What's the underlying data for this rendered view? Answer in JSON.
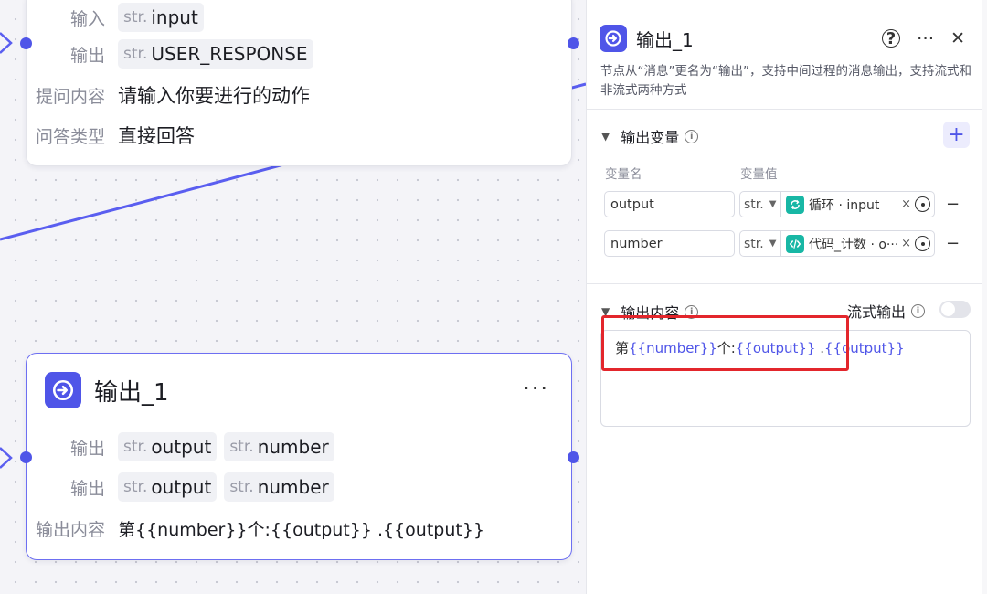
{
  "canvas": {
    "top_node": {
      "rows": [
        {
          "label": "输入",
          "chips": [
            {
              "type": "str.",
              "name": "input"
            }
          ]
        },
        {
          "label": "输出",
          "chips": [
            {
              "type": "str.",
              "name": "USER_RESPONSE"
            }
          ]
        },
        {
          "label": "提问内容",
          "text": "请输入你要进行的动作"
        },
        {
          "label": "问答类型",
          "text": "直接回答"
        }
      ]
    },
    "output_node": {
      "title": "输出_1",
      "more": "···",
      "rows": [
        {
          "label": "输出",
          "chips": [
            {
              "type": "str.",
              "name": "output"
            },
            {
              "type": "str.",
              "name": "number"
            }
          ]
        },
        {
          "label": "输出",
          "chips": [
            {
              "type": "str.",
              "name": "output"
            },
            {
              "type": "str.",
              "name": "number"
            }
          ]
        },
        {
          "label": "输出内容",
          "text": "第{{number}}个:{{output}} .{{output}}"
        }
      ]
    }
  },
  "panel": {
    "title": "输出_1",
    "help": "?",
    "more": "···",
    "close": "✕",
    "description": "节点从“消息”更名为“输出”，支持中间过程的消息输出，支持流式和非流式两种方式",
    "output_vars": {
      "title": "输出变量",
      "add": "+",
      "col_name": "变量名",
      "col_value": "变量值",
      "rows": [
        {
          "name": "output",
          "type": "str.",
          "ref": "循环 · input",
          "ref_icon": "loop-icon",
          "clear": "×",
          "remove": "−"
        },
        {
          "name": "number",
          "type": "str.",
          "ref": "代码_计数 · o···",
          "ref_icon": "code-icon",
          "clear": "×",
          "remove": "−"
        }
      ]
    },
    "output_content": {
      "title": "输出内容",
      "stream_label": "流式输出",
      "stream_on": false,
      "parts": [
        {
          "text": "第",
          "var": false
        },
        {
          "text": "{{number}}",
          "var": true
        },
        {
          "text": "个:",
          "var": false
        },
        {
          "text": "{{output}}",
          "var": true
        },
        {
          "text": " .",
          "var": false
        },
        {
          "text": "{{output}}",
          "var": true
        }
      ]
    }
  },
  "colors": {
    "accent": "#4f55e8",
    "ref_icon_bg": "#18b7a5",
    "highlight": "#e3262c"
  }
}
